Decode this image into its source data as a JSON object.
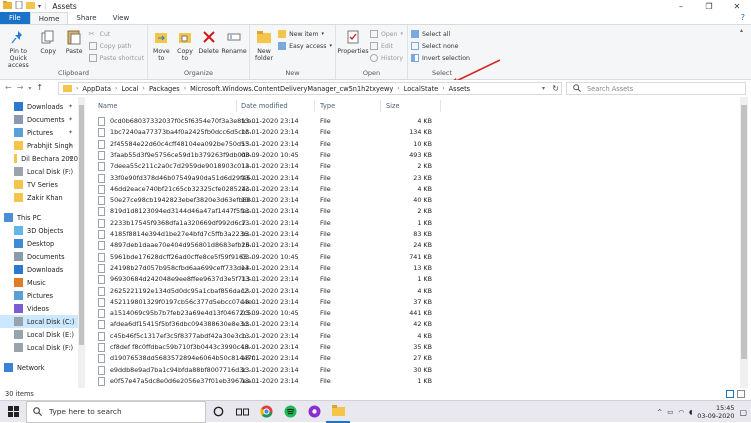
{
  "window": {
    "title": "Assets"
  },
  "tabs": [
    "File",
    "Home",
    "Share",
    "View"
  ],
  "ribbon": {
    "clipboard": {
      "label": "Clipboard",
      "pin": "Pin to Quick access",
      "copy": "Copy",
      "paste": "Paste",
      "cut": "Cut",
      "copy_path": "Copy path",
      "paste_shortcut": "Paste shortcut"
    },
    "organize": {
      "label": "Organize",
      "move_to": "Move to",
      "copy_to": "Copy to",
      "delete": "Delete",
      "rename": "Rename"
    },
    "new": {
      "label": "New",
      "new_folder": "New folder",
      "new_item": "New item",
      "easy_access": "Easy access"
    },
    "open": {
      "label": "Open",
      "properties": "Properties",
      "open": "Open",
      "edit": "Edit",
      "history": "History"
    },
    "select": {
      "label": "Select",
      "select_all": "Select all",
      "select_none": "Select none",
      "invert": "Invert selection"
    }
  },
  "address": {
    "crumbs": [
      "AppData",
      "Local",
      "Packages",
      "Microsoft.Windows.ContentDeliveryManager_cw5n1h2txyewy",
      "LocalState",
      "Assets"
    ]
  },
  "search": {
    "placeholder": "Search Assets"
  },
  "nav_pane": [
    {
      "label": "Downloads",
      "icon": "download-icon",
      "pinned": true
    },
    {
      "label": "Documents",
      "icon": "documents-icon",
      "pinned": true
    },
    {
      "label": "Pictures",
      "icon": "pictures-icon",
      "pinned": true
    },
    {
      "label": "Prabhjit Singh",
      "icon": "folder-icon",
      "pinned": true
    },
    {
      "label": "Dil Bechara 2020",
      "icon": "folder-icon",
      "pinned": true
    },
    {
      "label": "Local Disk (F:)",
      "icon": "drive-icon",
      "pinned": false
    },
    {
      "label": "TV Series",
      "icon": "folder-icon",
      "pinned": false
    },
    {
      "label": "Zakir Khan",
      "icon": "folder-icon",
      "pinned": false
    },
    {
      "label": "This PC",
      "icon": "pc-icon",
      "pinned": false
    },
    {
      "label": "3D Objects",
      "icon": "3d-objects-icon",
      "pinned": false
    },
    {
      "label": "Desktop",
      "icon": "desktop-icon",
      "pinned": false
    },
    {
      "label": "Documents",
      "icon": "documents-icon",
      "pinned": false
    },
    {
      "label": "Downloads",
      "icon": "download-icon",
      "pinned": false
    },
    {
      "label": "Music",
      "icon": "music-icon",
      "pinned": false
    },
    {
      "label": "Pictures",
      "icon": "pictures-icon",
      "pinned": false
    },
    {
      "label": "Videos",
      "icon": "videos-icon",
      "pinned": false
    },
    {
      "label": "Local Disk (C:)",
      "icon": "drive-icon",
      "pinned": false
    },
    {
      "label": "Local Disk (E:)",
      "icon": "drive-icon",
      "pinned": false
    },
    {
      "label": "Local Disk (F:)",
      "icon": "drive-icon",
      "pinned": false
    },
    {
      "label": "Network",
      "icon": "network-icon",
      "pinned": false
    }
  ],
  "columns": {
    "name": "Name",
    "date": "Date modified",
    "type": "Type",
    "size": "Size"
  },
  "files": [
    {
      "name": "0cd0b68037332037f0c5f6354e70f3a3e8fcb...",
      "date": "13-01-2020 23:14",
      "type": "File",
      "size": "4 KB"
    },
    {
      "name": "1bc7240aa77373ba4f0a2425fb0dcc6d5cbf...",
      "date": "13-01-2020 23:14",
      "type": "File",
      "size": "134 KB"
    },
    {
      "name": "2f45584e22d60c4cff48104ea092be750d55...",
      "date": "13-01-2020 23:14",
      "type": "File",
      "size": "10 KB"
    },
    {
      "name": "3faab55d3f9e5756ce59d1b379263f9db0d0...",
      "date": "03-09-2020 10:45",
      "type": "File",
      "size": "493 KB"
    },
    {
      "name": "7deea55c211c2a0c7d2959de9018903c01a...",
      "date": "13-01-2020 23:14",
      "type": "File",
      "size": "2 KB"
    },
    {
      "name": "33f0e90fd378d46b07549a90da51d6d29f46...",
      "date": "13-01-2020 23:14",
      "type": "File",
      "size": "23 KB"
    },
    {
      "name": "46dd2eace740bf21c65cb32325cfe028524c...",
      "date": "13-01-2020 23:14",
      "type": "File",
      "size": "4 KB"
    },
    {
      "name": "50e27ce98cb1942823ebef3820e3d63efb88...",
      "date": "13-01-2020 23:14",
      "type": "File",
      "size": "40 KB"
    },
    {
      "name": "819d1d8123094ed3144d46a47af1447f5fec...",
      "date": "13-01-2020 23:14",
      "type": "File",
      "size": "2 KB"
    },
    {
      "name": "2233b17545f9368dfa1a320669df992d6c7...",
      "date": "13-01-2020 23:14",
      "type": "File",
      "size": "1 KB"
    },
    {
      "name": "4185f8814e394d1be27e4bfd7c5ffb3a2236...",
      "date": "13-01-2020 23:14",
      "type": "File",
      "size": "83 KB"
    },
    {
      "name": "4897deb1daae70e404d956801d8683efb26...",
      "date": "13-01-2020 23:14",
      "type": "File",
      "size": "24 KB"
    },
    {
      "name": "5961bde17628dcff26ad0cffe8ce5f59f9163...",
      "date": "03-09-2020 10:45",
      "type": "File",
      "size": "741 KB"
    },
    {
      "name": "24198b27d057b958cfbd6aa699ceff733de4...",
      "date": "13-01-2020 23:14",
      "type": "File",
      "size": "13 KB"
    },
    {
      "name": "96930684d242048e9ee8ffee9637d3e5f713...",
      "date": "13-01-2020 23:14",
      "type": "File",
      "size": "1 KB"
    },
    {
      "name": "2625221192e134d5d0dc95a1cbaf856dac2...",
      "date": "13-01-2020 23:14",
      "type": "File",
      "size": "4 KB"
    },
    {
      "name": "452119801329f0197cb56c377d5ebcc07e4e...",
      "date": "13-01-2020 23:14",
      "type": "File",
      "size": "37 KB"
    },
    {
      "name": "a1514069c95b7b7feb23a69e4d13f04672c5...",
      "date": "03-09-2020 10:45",
      "type": "File",
      "size": "441 KB"
    },
    {
      "name": "afdea6df15415f5bf36dbc094388630e8e3d...",
      "date": "13-01-2020 23:14",
      "type": "File",
      "size": "42 KB"
    },
    {
      "name": "c45b46f5c1317ef3c5f8377abdf42a30e3cb...",
      "date": "13-01-2020 23:14",
      "type": "File",
      "size": "4 KB"
    },
    {
      "name": "cf8def f8c0ffdbac59b710f3b0443c3990c48...",
      "date": "13-01-2020 23:14",
      "type": "File",
      "size": "35 KB"
    },
    {
      "name": "d19076538dd5683572894e6064b50c81447f...",
      "date": "13-01-2020 23:14",
      "type": "File",
      "size": "27 KB"
    },
    {
      "name": "e9ddb8e9ad7ba1c94bfda88bf8007716d3c...",
      "date": "13-01-2020 23:14",
      "type": "File",
      "size": "30 KB"
    },
    {
      "name": "e0f57e47a5dc8e0d6e2056e37f01eb3967ea...",
      "date": "13-01-2020 23:14",
      "type": "File",
      "size": "1 KB"
    }
  ],
  "status": {
    "count": "30 items"
  },
  "taskbar": {
    "search_placeholder": "Type here to search",
    "apps": [
      "cortana-icon",
      "task-view-icon",
      "chrome-icon",
      "spotify-icon",
      "podcast-icon",
      "file-explorer-icon"
    ],
    "time": "15:45",
    "date": "03-09-2020"
  },
  "colors": {
    "accent": "#1a73c9",
    "selection": "#cce8ff",
    "annotation": "#d32a2a"
  }
}
